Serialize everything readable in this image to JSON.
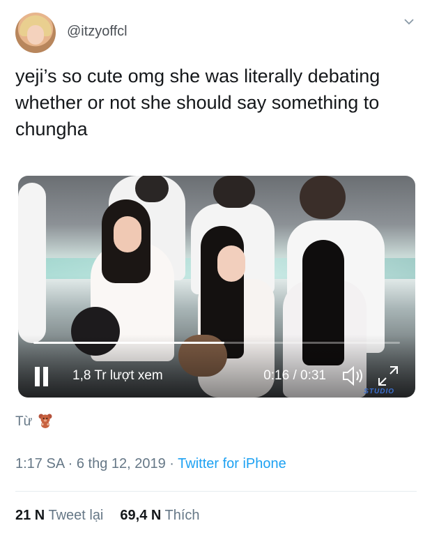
{
  "tweet": {
    "handle": "@itzyoffcl",
    "text": "yeji’s so cute omg she was literally debating whether or not she should say something to chungha",
    "media": {
      "views_label": "1,8 Tr lượt xem",
      "time_label": "0:16 / 0:31",
      "progress": 0.52,
      "watermark": "STUDIO"
    },
    "from_label": "Từ",
    "from_icon": "teddy-bear-emoji",
    "timestamp": "1:17 SA · 6 thg 12, 2019 · ",
    "client": "Twitter for iPhone",
    "retweets_count": "21 N",
    "retweets_label": "Tweet lại",
    "likes_count": "69,4 N",
    "likes_label": "Thích"
  },
  "colors": {
    "accent": "#1da1f2",
    "secondary_text": "#657786",
    "primary_text": "#14171a"
  }
}
